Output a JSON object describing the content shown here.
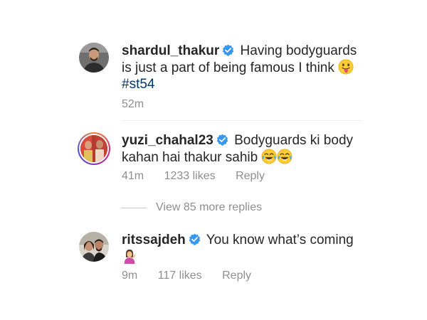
{
  "comments": [
    {
      "username": "shardul_thakur",
      "text_line1": "Having bodyguards",
      "text_line2": "is just a part of being famous I think",
      "hashtag": "#st54",
      "time": "52m"
    },
    {
      "username": "yuzi_chahal23",
      "text_line1": "Bodyguards ki body",
      "text_line2": "kahan hai thakur sahib",
      "time": "41m",
      "likes": "1233 likes",
      "reply": "Reply"
    },
    {
      "username": "ritssajdeh",
      "text_line1": "You know what’s coming",
      "time": "9m",
      "likes": "117 likes",
      "reply": "Reply"
    }
  ],
  "more_replies": "View 85 more replies",
  "colors": {
    "verified": "#3897f0",
    "hashtag": "#00376b",
    "meta": "#8e8e8e"
  }
}
